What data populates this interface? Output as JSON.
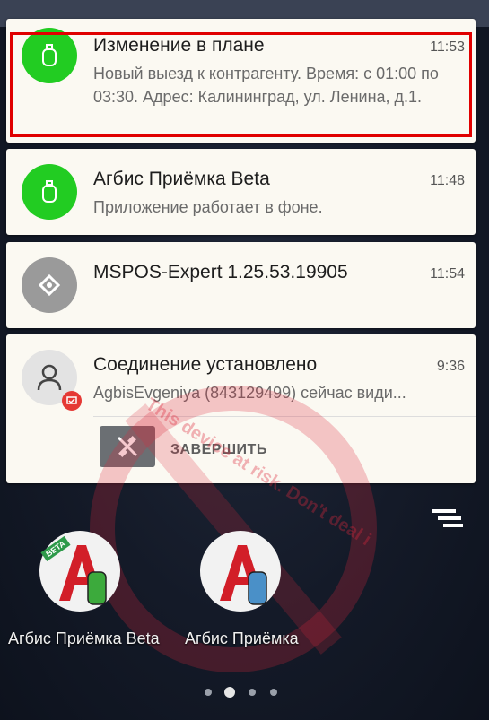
{
  "notifications": [
    {
      "title": "Изменение в плане",
      "time": "11:53",
      "body": "Новый выезд к контрагенту. Время: с 01:00 по 03:30. Адрес: Калининград, ул. Ленина, д.1."
    },
    {
      "title": "Агбис Приёмка Beta",
      "time": "11:48",
      "body": "Приложение работает в фоне."
    },
    {
      "title": "MSPOS-Expert 1.25.53.19905",
      "time": "11:54"
    },
    {
      "title": "Соединение установлено",
      "time": "9:36",
      "body": "AgbisEvgeniya (843129499) сейчас види...",
      "action_label": "ЗАВЕРШИТЬ"
    }
  ],
  "watermark": "This device at risk. Don't deal i",
  "home": {
    "apps": [
      {
        "label": "Агбис Приёмка Beta",
        "badge": "BETA"
      },
      {
        "label": "Агбис Приёмка"
      }
    ]
  },
  "colors": {
    "accent_green": "#22cc22",
    "highlight_red": "#e00000",
    "brand_red": "#d21e28"
  }
}
